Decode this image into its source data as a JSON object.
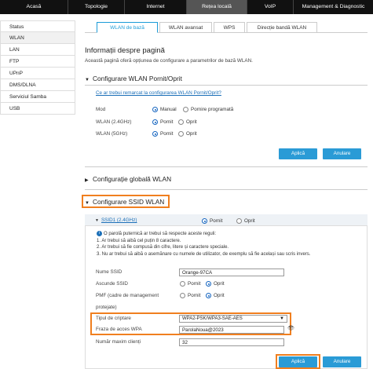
{
  "topnav": [
    "Acasă",
    "Topologie",
    "Internet",
    "Rețea locală",
    "VoIP",
    "Management & Diagnostic"
  ],
  "sidebar": [
    "Status",
    "WLAN",
    "LAN",
    "FTP",
    "UPnP",
    "DMS/DLNA",
    "Serviciul Samba",
    "USB"
  ],
  "tabs": [
    "WLAN de bază",
    "WLAN avansat",
    "WPS",
    "Direcție bandă WLAN"
  ],
  "page": {
    "title": "Informații despre pagină",
    "description": "Această pagină oferă opțiunea de configurare a parametrilor de bază WLAN."
  },
  "section1": {
    "title": "Configurare WLAN Pornit/Oprit",
    "link": "Ce ar trebui remarcat la configurarea WLAN Pornit/Oprit?",
    "rows": [
      {
        "label": "Mod",
        "opt1": "Manual",
        "opt2": "Pornire programată"
      },
      {
        "label": "WLAN (2.4GHz)",
        "opt1": "Pornit",
        "opt2": "Oprit"
      },
      {
        "label": "WLAN (5GHz)",
        "opt1": "Pornit",
        "opt2": "Oprit"
      }
    ],
    "apply": "Aplică",
    "cancel": "Anulare"
  },
  "section2": {
    "title": "Configurație globală WLAN"
  },
  "section3": {
    "title": "Configurare SSID WLAN",
    "ssid_tab": "SSID1 (2.4GHz)",
    "ssid_on": "Pornit",
    "ssid_off": "Oprit",
    "note_line1": "O parolă puternică ar trebui să respecte aceste reguli:",
    "note_line2": "1. Ar trebui să aibă cel puțin 8 caractere.",
    "note_line3": "2. Ar trebui să fie compusă din cifre, litere și caractere speciale.",
    "note_line4": "3. Nu ar trebui să aibă o asemănare cu numele de utilizator, de exemplu să fie același sau scris invers.",
    "ssid_name_label": "Nume SSID",
    "ssid_name_value": "Orange-97CA",
    "hide_label": "Ascunde SSID",
    "pmf_label": "PMF (cadre de management",
    "pmf_label2": "protejate)",
    "opt_on": "Pornit",
    "opt_off": "Oprit",
    "enc_label": "Tipul de criptare",
    "enc_value": "WPA2-PSK/WPA3-SAE-AES",
    "key_label": "Fraza de acces WPA",
    "key_value": "ParolaNoua@2023",
    "max_label": "Număr maxim clienți",
    "max_value": "32",
    "apply": "Aplică",
    "cancel": "Anulare"
  }
}
